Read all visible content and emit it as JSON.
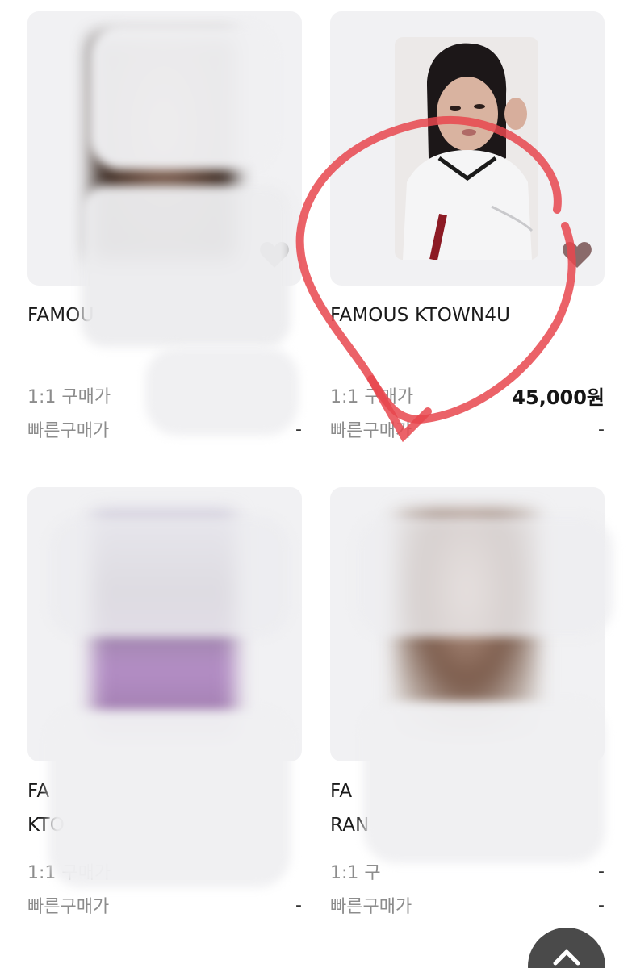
{
  "products": [
    {
      "title": "FAMOU",
      "price_rows": [
        {
          "label": "1:1 구매가",
          "value": ""
        },
        {
          "label": "빠른구매가",
          "value": "-"
        }
      ],
      "redacted": true
    },
    {
      "title": "FAMOUS KTOWN4U",
      "price_rows": [
        {
          "label": "1:1 구매가",
          "value": "45,000원"
        },
        {
          "label": "빠른구매가",
          "value": "-"
        }
      ],
      "redacted": false
    },
    {
      "title_lines": [
        "FA",
        "KTO"
      ],
      "price_rows": [
        {
          "label": "1:1 구매가",
          "value": ""
        },
        {
          "label": "빠른구매가",
          "value": "-"
        }
      ],
      "redacted": true
    },
    {
      "title_lines": [
        "FA",
        "RAN"
      ],
      "price_rows": [
        {
          "label": "1:1 구",
          "value": "-"
        },
        {
          "label": "빠른구매가",
          "value": "-"
        }
      ],
      "redacted": true
    }
  ],
  "icons": {
    "heart": "heart-icon",
    "scroll_top": "chevron-up-icon"
  },
  "colors": {
    "annotation": "#e8474d",
    "card_bg": "#f1f1f3",
    "label": "#8c8c8c"
  }
}
